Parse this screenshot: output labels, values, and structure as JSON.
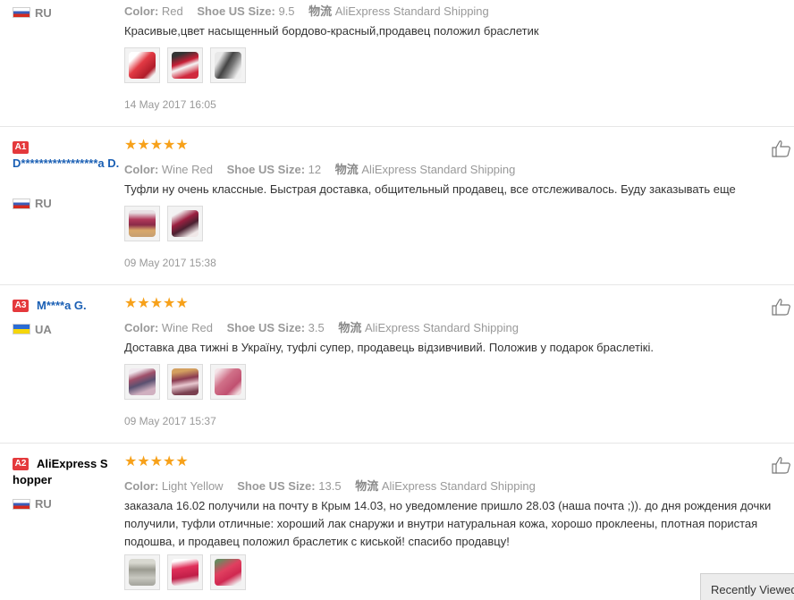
{
  "labels": {
    "color": "Color:",
    "size": "Shoe US Size:",
    "shipping_icon": "物流",
    "stars": "★★★★★"
  },
  "reviews": [
    {
      "country": "RU",
      "color": "Red",
      "size": "9.5",
      "shipping": "AliExpress Standard Shipping",
      "text": "Красивые,цвет насыщенный бордово-красный,продавец положил браслетик",
      "date": "14 May 2017 16:05"
    },
    {
      "badge": "A1",
      "user": "D*****************a D.",
      "country": "RU",
      "rating": 5,
      "color": "Wine Red",
      "size": "12",
      "shipping": "AliExpress Standard Shipping",
      "text": "Туфли ну очень классные. Быстрая доставка, общительный продавец, все отслеживалось. Буду заказывать еще",
      "date": "09 May 2017 15:38"
    },
    {
      "badge": "A3",
      "user": "M****a G.",
      "country": "UA",
      "rating": 5,
      "color": "Wine Red",
      "size": "3.5",
      "shipping": "AliExpress Standard Shipping",
      "text": "Доставка два тижні в Україну, туфлі супер, продавець відзивчивий. Положив у подарок браслетікі.",
      "date": "09 May 2017 15:37"
    },
    {
      "badge": "A2",
      "user": "AliExpress Shopper",
      "country": "RU",
      "rating": 5,
      "color": "Light Yellow",
      "size": "13.5",
      "shipping": "AliExpress Standard Shipping",
      "text": "заказала 16.02 получили на почту в Крым 14.03, но уведомление пришло 28.03 (наша почта ;)). до дня рождения дочки получили, туфли отличные: хороший лак снаружи и внутри натуральная кожа, хорошо проклеены, плотная пористая подошва, и продавец положил браслетик с киськой! спасибо продавцу!"
    }
  ],
  "recently_viewed": "Recently Viewed",
  "colors": {
    "badge": "#e4393c",
    "username": "#1a5fb4",
    "star": "#f7a11a",
    "meta_text": "#999999"
  },
  "icons": [
    "thumbs-up-icon",
    "shipping-icon",
    "flag-ru-icon",
    "flag-ua-icon"
  ]
}
